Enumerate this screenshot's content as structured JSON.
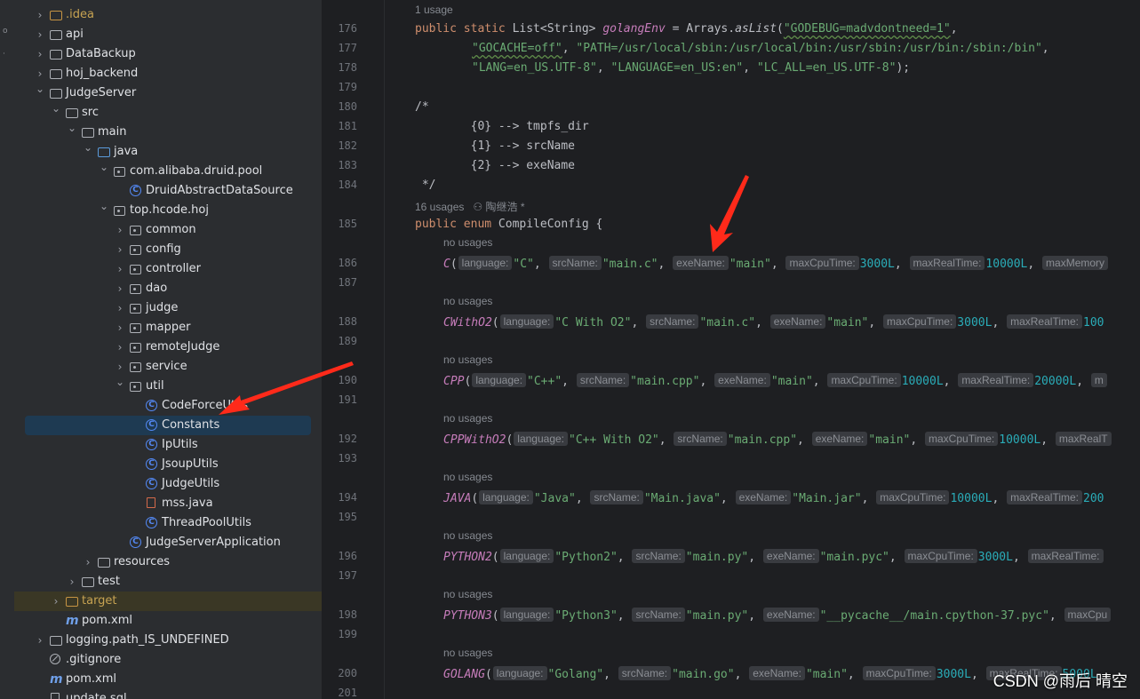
{
  "sidebar_tree": [
    {
      "label": ".idea",
      "icon": "folder-icon",
      "style": "orange",
      "collapsed": true
    },
    {
      "label": "api",
      "icon": "folder-icon",
      "collapsed": true
    },
    {
      "label": "DataBackup",
      "icon": "folder-icon",
      "collapsed": true
    },
    {
      "label": "hoj_backend",
      "icon": "folder-icon",
      "collapsed": true
    },
    {
      "label": "JudgeServer",
      "icon": "folder-icon",
      "expanded": true
    },
    {
      "label": "src",
      "icon": "folder-icon",
      "expanded": true
    },
    {
      "label": "main",
      "icon": "folder-icon",
      "expanded": true
    },
    {
      "label": "java",
      "icon": "source-folder-icon",
      "expanded": true
    },
    {
      "label": "com.alibaba.druid.pool",
      "icon": "package-icon",
      "expanded": true
    },
    {
      "label": "DruidAbstractDataSource",
      "icon": "class-icon"
    },
    {
      "label": "top.hcode.hoj",
      "icon": "package-icon",
      "expanded": true
    },
    {
      "label": "common",
      "icon": "package-icon",
      "collapsed": true
    },
    {
      "label": "config",
      "icon": "package-icon",
      "collapsed": true
    },
    {
      "label": "controller",
      "icon": "package-icon",
      "collapsed": true
    },
    {
      "label": "dao",
      "icon": "package-icon",
      "collapsed": true
    },
    {
      "label": "judge",
      "icon": "package-icon",
      "collapsed": true
    },
    {
      "label": "mapper",
      "icon": "package-icon",
      "collapsed": true
    },
    {
      "label": "remoteJudge",
      "icon": "package-icon",
      "collapsed": true
    },
    {
      "label": "service",
      "icon": "package-icon",
      "collapsed": true
    },
    {
      "label": "util",
      "icon": "package-icon",
      "expanded": true
    },
    {
      "label": "CodeForceUtils",
      "icon": "class-icon"
    },
    {
      "label": "Constants",
      "icon": "class-icon",
      "selected": true
    },
    {
      "label": "IpUtils",
      "icon": "class-icon"
    },
    {
      "label": "JsoupUtils",
      "icon": "class-icon"
    },
    {
      "label": "JudgeUtils",
      "icon": "class-icon"
    },
    {
      "label": "mss.java",
      "icon": "java-file-icon"
    },
    {
      "label": "ThreadPoolUtils",
      "icon": "class-icon"
    },
    {
      "label": "JudgeServerApplication",
      "icon": "spring-class-icon"
    },
    {
      "label": "resources",
      "icon": "resources-folder-icon",
      "collapsed": true
    },
    {
      "label": "test",
      "icon": "folder-icon",
      "collapsed": true
    },
    {
      "label": "target",
      "icon": "excluded-folder-icon",
      "style": "orange",
      "collapsed": true
    },
    {
      "label": "pom.xml",
      "icon": "maven-icon"
    },
    {
      "label": "logging.path_IS_UNDEFINED",
      "icon": "folder-icon",
      "collapsed": true
    },
    {
      "label": ".gitignore",
      "icon": "ignore-file-icon"
    },
    {
      "label": "pom.xml",
      "icon": "maven-icon"
    },
    {
      "label": "update.sql",
      "icon": "sql-file-icon"
    }
  ],
  "line_numbers": [
    "176",
    "177",
    "178",
    "179",
    "180",
    "181",
    "182",
    "183",
    "184",
    "185",
    "186",
    "187",
    "188",
    "189",
    "190",
    "191",
    "192",
    "193",
    "194",
    "195",
    "196",
    "197",
    "198",
    "199",
    "200",
    "201"
  ],
  "usage_labels": {
    "u1": "1 usage",
    "u16": "16 usages",
    "author": "陶继浩 *",
    "no_usages": "no usages"
  },
  "code": {
    "l176_a": "public static ",
    "l176_b": "List<String> ",
    "l176_c": "golangEnv",
    "l176_d": " = Arrays.",
    "l176_e": "asList",
    "l176_f": "(",
    "l176_g": "\"GODEBUG=madvdontneed=1\"",
    "l176_h": ",",
    "l177_a": "\"GOCACHE=off\"",
    "l177_b": ", ",
    "l177_c": "\"PATH=/usr/local/sbin:/usr/local/bin:/usr/sbin:/usr/bin:/sbin:/bin\"",
    "l177_d": ",",
    "l178_a": "\"LANG=en_US.UTF-8\"",
    "l178_b": ", ",
    "l178_c": "\"LANGUAGE=en_US:en\"",
    "l178_d": ", ",
    "l178_e": "\"LC_ALL=en_US.UTF-8\"",
    "l178_f": ");",
    "l180": "/*",
    "l181": "        {0} --> tmpfs_dir",
    "l182": "        {1} --> srcName",
    "l183": "        {2} --> exeName",
    "l184": " */",
    "l185_a": "public enum ",
    "l185_b": "CompileConfig {"
  },
  "enum_entries": [
    {
      "name": "C",
      "args": [
        [
          "language:",
          "\"C\""
        ],
        [
          "srcName:",
          "\"main.c\""
        ],
        [
          "exeName:",
          "\"main\""
        ],
        [
          "maxCpuTime:",
          "3000L"
        ],
        [
          "maxRealTime:",
          "10000L"
        ],
        [
          "maxMemory",
          ""
        ]
      ]
    },
    {
      "name": "CWithO2",
      "args": [
        [
          "language:",
          "\"C With O2\""
        ],
        [
          "srcName:",
          "\"main.c\""
        ],
        [
          "exeName:",
          "\"main\""
        ],
        [
          "maxCpuTime:",
          "3000L"
        ],
        [
          "maxRealTime:",
          "100"
        ]
      ]
    },
    {
      "name": "CPP",
      "args": [
        [
          "language:",
          "\"C++\""
        ],
        [
          "srcName:",
          "\"main.cpp\""
        ],
        [
          "exeName:",
          "\"main\""
        ],
        [
          "maxCpuTime:",
          "10000L"
        ],
        [
          "maxRealTime:",
          "20000L"
        ],
        [
          "m",
          ""
        ]
      ]
    },
    {
      "name": "CPPWithO2",
      "args": [
        [
          "language:",
          "\"C++ With O2\""
        ],
        [
          "srcName:",
          "\"main.cpp\""
        ],
        [
          "exeName:",
          "\"main\""
        ],
        [
          "maxCpuTime:",
          "10000L"
        ],
        [
          "maxRealT",
          ""
        ]
      ]
    },
    {
      "name": "JAVA",
      "args": [
        [
          "language:",
          "\"Java\""
        ],
        [
          "srcName:",
          "\"Main.java\""
        ],
        [
          "exeName:",
          "\"Main.jar\""
        ],
        [
          "maxCpuTime:",
          "10000L"
        ],
        [
          "maxRealTime:",
          "200"
        ]
      ]
    },
    {
      "name": "PYTHON2",
      "args": [
        [
          "language:",
          "\"Python2\""
        ],
        [
          "srcName:",
          "\"main.py\""
        ],
        [
          "exeName:",
          "\"main.pyc\""
        ],
        [
          "maxCpuTime:",
          "3000L"
        ],
        [
          "maxRealTime:",
          ""
        ]
      ]
    },
    {
      "name": "PYTHON3",
      "args": [
        [
          "language:",
          "\"Python3\""
        ],
        [
          "srcName:",
          "\"main.py\""
        ],
        [
          "exeName:",
          "\"__pycache__/main.cpython-37.pyc\""
        ],
        [
          "maxCpu",
          ""
        ]
      ]
    },
    {
      "name": "GOLANG",
      "args": [
        [
          "language:",
          "\"Golang\""
        ],
        [
          "srcName:",
          "\"main.go\""
        ],
        [
          "exeName:",
          "\"main\""
        ],
        [
          "maxCpuTime:",
          "3000L"
        ],
        [
          "maxRealTime:",
          "5000L"
        ]
      ]
    }
  ],
  "watermark": "CSDN @雨后 晴空",
  "colors": {
    "accent": "#548af7",
    "arrow": "#ff2a1a",
    "selection": "#1e3a52"
  }
}
